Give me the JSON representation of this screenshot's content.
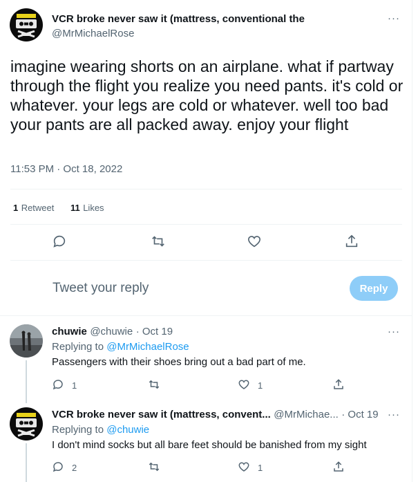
{
  "main_tweet": {
    "display_name": "VCR broke never saw it (mattress, conventional the",
    "handle": "@MrMichaelRose",
    "text": "imagine wearing shorts on an airplane. what if partway through the flight you realize you need pants. it's cold or whatever. your legs are cold or whatever. well too bad your pants are all packed away. enjoy your flight",
    "timestamp": "11:53 PM · Oct 18, 2022",
    "retweet_count": "1",
    "retweet_label": "Retweet",
    "like_count": "11",
    "like_label": "Likes",
    "more": "···"
  },
  "reply_box": {
    "placeholder": "Tweet your reply",
    "button_label": "Reply"
  },
  "replies": [
    {
      "display_name": "chuwie",
      "handle": "@chuwie",
      "date": "· Oct 19",
      "replying_prefix": "Replying to ",
      "replying_to": "@MrMichaelRose",
      "text": "Passengers with their shoes bring out a bad part of me.",
      "reply_count": "1",
      "like_count": "1",
      "more": "···"
    },
    {
      "display_name": "VCR broke never saw it (mattress, convent...",
      "handle": "@MrMichae...",
      "date": "· Oct 19",
      "replying_prefix": "Replying to ",
      "replying_to": "@chuwie",
      "text": "I don't mind socks but all bare feet should be banished from my sight",
      "reply_count": "2",
      "like_count": "1",
      "more": "···"
    }
  ],
  "colors": {
    "accent": "#1d9bf0",
    "reply_button": "#8ecdf8",
    "secondary_text": "#536471",
    "divider": "#eff3f4"
  },
  "icons": [
    "comment-icon",
    "retweet-icon",
    "heart-icon",
    "share-icon",
    "more-icon"
  ]
}
